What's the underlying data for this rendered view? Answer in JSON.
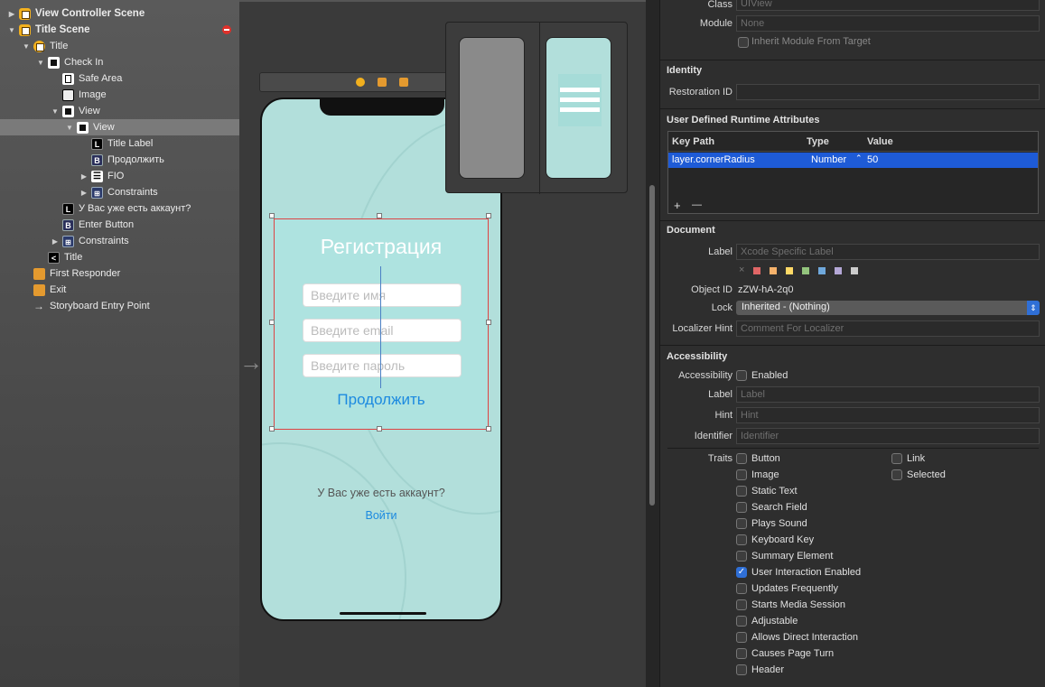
{
  "outline": {
    "rows": [
      {
        "label": "View Controller Scene",
        "level": 0,
        "tri": "▶",
        "icon": "y",
        "name": "outline-row-view-controller-scene",
        "bold": true
      },
      {
        "label": "Title Scene",
        "level": 0,
        "tri": "▼",
        "icon": "y",
        "name": "outline-row-title-scene",
        "bold": true,
        "err": true
      },
      {
        "label": "Title",
        "level": 1,
        "tri": "▼",
        "icon": "yc",
        "name": "outline-row-title-controller"
      },
      {
        "label": "Check In",
        "level": 2,
        "tri": "▼",
        "icon": "wbox",
        "name": "outline-row-check-in"
      },
      {
        "label": "Safe Area",
        "level": 3,
        "tri": "",
        "icon": "safe",
        "name": "outline-row-safe-area"
      },
      {
        "label": "Image",
        "level": 3,
        "tri": "",
        "icon": "img",
        "name": "outline-row-image"
      },
      {
        "label": "View",
        "level": 3,
        "tri": "▼",
        "icon": "wbox",
        "name": "outline-row-view"
      },
      {
        "label": "View",
        "level": 4,
        "tri": "▼",
        "icon": "wbox",
        "name": "outline-row-inner-view",
        "sel": true
      },
      {
        "label": "Title Label",
        "level": 5,
        "tri": "",
        "icon": "blk",
        "glyph": "L",
        "name": "outline-row-title-label"
      },
      {
        "label": "Продолжить",
        "level": 5,
        "tri": "",
        "icon": "blue",
        "glyph": "B",
        "name": "outline-row-continue-button"
      },
      {
        "label": "FIO",
        "level": 5,
        "tri": "▶",
        "icon": "list",
        "glyph": "☰",
        "name": "outline-row-fio"
      },
      {
        "label": "Constraints",
        "level": 5,
        "tri": "▶",
        "icon": "cons",
        "glyph": "⊞",
        "name": "outline-row-constraints-inner"
      },
      {
        "label": "У Вас уже есть аккаунт?",
        "level": 3,
        "tri": "",
        "icon": "blk",
        "glyph": "L",
        "name": "outline-row-account-label"
      },
      {
        "label": "Enter Button",
        "level": 3,
        "tri": "",
        "icon": "blue",
        "glyph": "B",
        "name": "outline-row-enter-button"
      },
      {
        "label": "Constraints",
        "level": 3,
        "tri": "▶",
        "icon": "cons",
        "glyph": "⊞",
        "name": "outline-row-constraints"
      },
      {
        "label": "Title",
        "level": 2,
        "tri": "",
        "icon": "blk",
        "glyph": "<",
        "name": "outline-row-title-nav"
      },
      {
        "label": "First Responder",
        "level": 1,
        "tri": "",
        "icon": "cube",
        "glyph": "",
        "name": "outline-row-first-responder"
      },
      {
        "label": "Exit",
        "level": 1,
        "tri": "",
        "icon": "exit",
        "glyph": "",
        "name": "outline-row-exit"
      },
      {
        "label": "Storyboard Entry Point",
        "level": 1,
        "tri": "",
        "icon": "arrow",
        "glyph": "→",
        "name": "outline-row-entry-point"
      }
    ]
  },
  "phone": {
    "title": "Регистрация",
    "name_ph": "Введите имя",
    "email_ph": "Введите email",
    "pass_ph": "Введите пароль",
    "continue": "Продолжить",
    "account": "У Вас уже есть аккаунт?",
    "login": "Войти"
  },
  "inspector": {
    "class_label": "Class",
    "class_value": "UIView",
    "module_label": "Module",
    "module_value": "None",
    "inherit": "Inherit Module From Target",
    "identity": "Identity",
    "restoration_label": "Restoration ID",
    "udra": "User Defined Runtime Attributes",
    "col_key": "Key Path",
    "col_type": "Type",
    "col_value": "Value",
    "row_key": "layer.cornerRadius",
    "row_type": "Number",
    "row_value": "50",
    "add": "+",
    "remove": "—",
    "document": "Document",
    "doc_label": "Label",
    "doc_label_ph": "Xcode Specific Label",
    "objid_label": "Object ID",
    "objid": "zZW-hA-2q0",
    "lock_label": "Lock",
    "lock_value": "Inherited - (Nothing)",
    "hint_label": "Localizer Hint",
    "hint_ph": "Comment For Localizer",
    "accessibility": "Accessibility",
    "acc_label": "Accessibility",
    "acc_enabled": "Enabled",
    "a_label": "Label",
    "a_label_ph": "Label",
    "a_hint": "Hint",
    "a_hint_ph": "Hint",
    "a_id": "Identifier",
    "a_id_ph": "Identifier",
    "traits_label": "Traits",
    "traits_left": [
      "Button",
      "Image",
      "Static Text",
      "Search Field",
      "Plays Sound",
      "Keyboard Key",
      "Summary Element",
      "User Interaction Enabled",
      "Updates Frequently",
      "Starts Media Session",
      "Adjustable",
      "Allows Direct Interaction",
      "Causes Page Turn",
      "Header"
    ],
    "traits_right": [
      "Link",
      "Selected"
    ],
    "checked": "User Interaction Enabled",
    "swatches": [
      "#e06666",
      "#f6b26b",
      "#ffd966",
      "#93c47d",
      "#6fa8dc",
      "#b4a7d6",
      "#cccccc"
    ]
  }
}
